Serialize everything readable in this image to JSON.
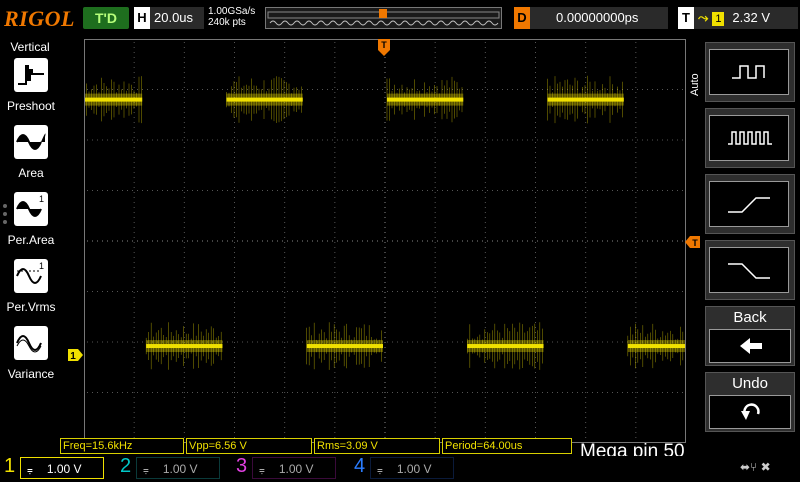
{
  "brand": "RIGOL",
  "run_state": "T'D",
  "timebase": {
    "key": "H",
    "value": "20.0us"
  },
  "sample": {
    "rate": "1.00GSa/s",
    "points": "240k pts"
  },
  "delay": {
    "key": "D",
    "value": "0.00000000ps"
  },
  "trigger": {
    "key": "T",
    "source": "1",
    "level": "2.32 V"
  },
  "left_menu": {
    "title": "Vertical",
    "items": [
      {
        "label": "Preshoot"
      },
      {
        "label": "Area"
      },
      {
        "label": "Per.Area"
      },
      {
        "label": "Per.Vrms"
      },
      {
        "label": "Variance"
      }
    ]
  },
  "right_menu": {
    "auto_label": "Auto",
    "back_label": "Back",
    "undo_label": "Undo"
  },
  "markers": {
    "trigger_top": "T",
    "channel1": "1",
    "trigger_level": "T"
  },
  "measurements": {
    "freq": "Freq=15.6kHz",
    "vpp": "Vpp=6.56 V",
    "rms": "Rms=3.09 V",
    "period": "Period=64.00us"
  },
  "annotation": "Mega pin 50",
  "channels": [
    {
      "num": "1",
      "scale": "1.00 V",
      "color": "#f0e000",
      "active": true
    },
    {
      "num": "2",
      "scale": "1.00 V",
      "color": "#00c8c8",
      "active": false
    },
    {
      "num": "3",
      "scale": "1.00 V",
      "color": "#e040e0",
      "active": false
    },
    {
      "num": "4",
      "scale": "1.00 V",
      "color": "#2a7cff",
      "active": false
    }
  ],
  "waveform": {
    "color": "#f0e000",
    "period_divisions": 3.2,
    "high_fraction": 0.15,
    "low_fraction": 0.76
  }
}
